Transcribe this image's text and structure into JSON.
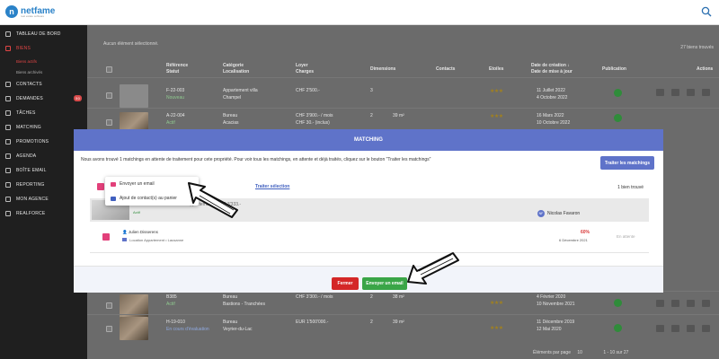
{
  "app": {
    "logo_text": "netfame",
    "logo_sub": "real estate software"
  },
  "sidebar": {
    "items": [
      {
        "label": "TABLEAU DE BORD"
      },
      {
        "label": "BIENS",
        "active": true
      },
      {
        "label": "CONTACTS"
      },
      {
        "label": "DEMANDES",
        "badge": "50"
      },
      {
        "label": "TÂCHES"
      },
      {
        "label": "MATCHING"
      },
      {
        "label": "PROMOTIONS"
      },
      {
        "label": "AGENDA"
      },
      {
        "label": "BOÎTE EMAIL"
      },
      {
        "label": "REPORTING",
        "badge": "9"
      },
      {
        "label": "MON AGENCE"
      },
      {
        "label": "REALFORCE"
      }
    ],
    "subitems": [
      {
        "label": "Biens actifs",
        "active": true
      },
      {
        "label": "Biens archivés"
      }
    ]
  },
  "list": {
    "selection_text": "Aucun élément sélectionné.",
    "count_text": "27 biens trouvés",
    "headers": {
      "reference": "Référence",
      "statut": "Statut",
      "categorie": "Catégorie",
      "localisation": "Localisation",
      "loyer": "Loyer",
      "charges": "Charges",
      "dimensions": "Dimensions",
      "contacts": "Contacts",
      "etoiles": "Etoiles",
      "date_creation": "Date de création ↓",
      "mise_a_jour": "Date de mise à jour",
      "publication": "Publication",
      "actions": "Actions"
    },
    "rows": [
      {
        "ref": "F-22-003",
        "status": "Nouveau",
        "category": "Appartement villa",
        "location": "Champel",
        "rent": "CHF 2'500.-",
        "charges": "",
        "dims1": "3",
        "dims2": "",
        "created": "11 Juillet 2022",
        "updated": "4 Octobre 2022"
      },
      {
        "ref": "A-22-004",
        "status": "Actif",
        "category": "Bureau",
        "location": "Acacias",
        "rent": "CHF 3'900.- / mois",
        "charges": "CHF 30.- (inclus)",
        "dims1": "2",
        "dims2": "39 m²",
        "created": "16 Mars 2022",
        "updated": "10 Octobre 2022"
      },
      {
        "ref": "B385",
        "status": "Actif",
        "category": "Bureau",
        "location": "Bastions - Tranchées",
        "rent": "CHF 3'300.- / mois",
        "charges": "",
        "dims1": "2",
        "dims2": "38 m²",
        "created": "4 Février 2020",
        "updated": "10 Novembre 2021"
      },
      {
        "ref": "H-19-010",
        "status": "En cours d'évaluation",
        "category": "Bureau",
        "location": "Veyrier-du-Lac",
        "rent": "EUR 1'500'000.-",
        "charges": "",
        "dims1": "2",
        "dims2": "39 m²",
        "created": "11 Décembre 2019",
        "updated": "12 Mai 2020"
      }
    ],
    "pager": {
      "per_page_label": "Éléments par page",
      "per_page": "10",
      "range": "1 - 10 sur 27"
    }
  },
  "modal": {
    "title": "MATCHING",
    "intro": "Nous avons trouvé 1 matchings en attente de traitement pour cete propriété. Pour voir tous les matchings, en attente et déjà traités, cliquez sur le bouton \"Traiter les matchings\"",
    "traiter_button": "Traiter les matchings",
    "traiter_selection": "Traiter sélection",
    "found": "1 bien trouvé",
    "property": {
      "ref": "W-3YRC-0003 • Location • Appartement • CHF 3'333.-",
      "status": "Actif",
      "agent_initials": "NF",
      "agent": "Nicolas Favaron"
    },
    "contact": {
      "name": "Julien Disserens",
      "detail": "Location Appartement • Lausanne",
      "pct": "60%",
      "date": "6 Décembre 2021",
      "status": "En attente"
    },
    "close_button": "Fermer",
    "email_button": "Envoyer un email"
  },
  "dropdown": {
    "items": [
      {
        "label": "Envoyer un email",
        "icon": "mail-icon",
        "color": "#e2407a"
      },
      {
        "label": "Ajout de contact(s) au panier",
        "icon": "cart-icon",
        "color": "#4160bf"
      }
    ]
  },
  "colors": {
    "accent": "#5f73c9",
    "danger": "#d42727",
    "success": "#3aa547",
    "pink": "#e2407a"
  }
}
